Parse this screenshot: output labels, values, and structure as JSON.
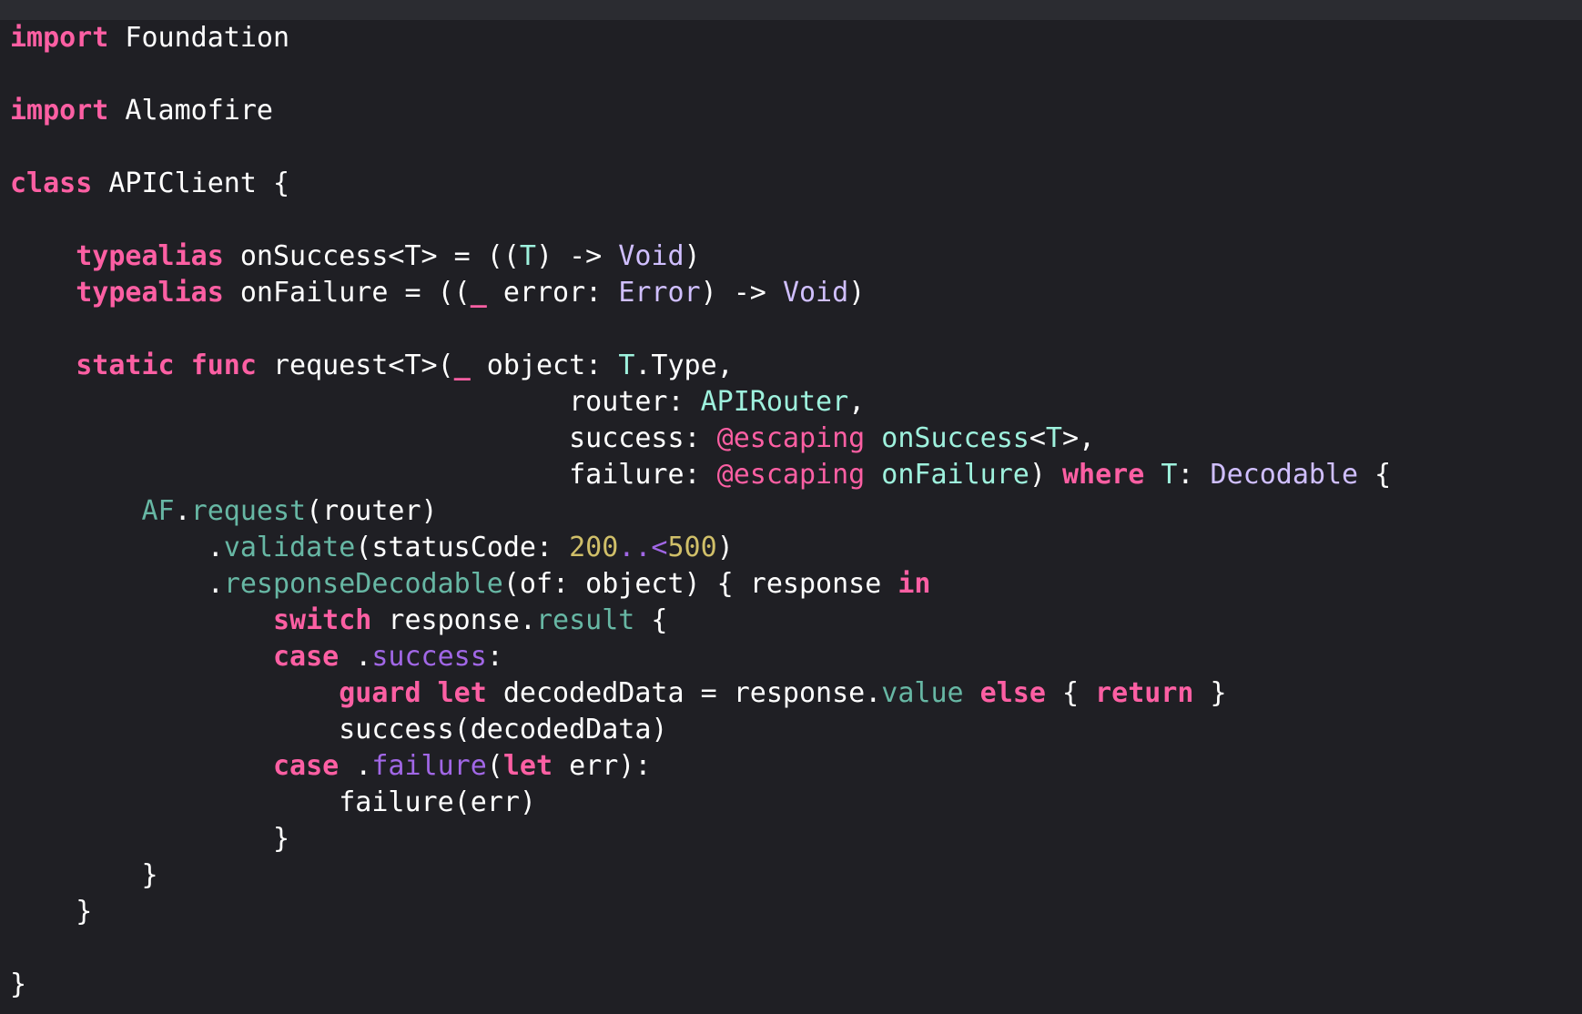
{
  "editor": {
    "language": "Swift",
    "lines": [
      [
        {
          "t": "import",
          "k": "keyword"
        },
        {
          "t": " Foundation",
          "k": "plain"
        }
      ],
      [],
      [
        {
          "t": "import",
          "k": "keyword"
        },
        {
          "t": " Alamofire",
          "k": "plain"
        }
      ],
      [],
      [
        {
          "t": "class",
          "k": "keyword"
        },
        {
          "t": " APIClient {",
          "k": "plain"
        }
      ],
      [],
      [
        {
          "t": "    ",
          "k": "plain"
        },
        {
          "t": "typealias",
          "k": "keyword"
        },
        {
          "t": " onSuccess<T> = ((",
          "k": "plain"
        },
        {
          "t": "T",
          "k": "project"
        },
        {
          "t": ") -> ",
          "k": "plain"
        },
        {
          "t": "Void",
          "k": "type"
        },
        {
          "t": ")",
          "k": "plain"
        }
      ],
      [
        {
          "t": "    ",
          "k": "plain"
        },
        {
          "t": "typealias",
          "k": "keyword"
        },
        {
          "t": " onFailure = ((",
          "k": "plain"
        },
        {
          "t": "_",
          "k": "keyword"
        },
        {
          "t": " error: ",
          "k": "plain"
        },
        {
          "t": "Error",
          "k": "type"
        },
        {
          "t": ") -> ",
          "k": "plain"
        },
        {
          "t": "Void",
          "k": "type"
        },
        {
          "t": ")",
          "k": "plain"
        }
      ],
      [],
      [
        {
          "t": "    ",
          "k": "plain"
        },
        {
          "t": "static",
          "k": "keyword"
        },
        {
          "t": " ",
          "k": "plain"
        },
        {
          "t": "func",
          "k": "keyword"
        },
        {
          "t": " request<T>(",
          "k": "plain"
        },
        {
          "t": "_",
          "k": "keyword"
        },
        {
          "t": " object: ",
          "k": "plain"
        },
        {
          "t": "T",
          "k": "project"
        },
        {
          "t": ".Type,",
          "k": "plain"
        }
      ],
      [
        {
          "t": "                                  router: ",
          "k": "plain"
        },
        {
          "t": "APIRouter",
          "k": "project"
        },
        {
          "t": ",",
          "k": "plain"
        }
      ],
      [
        {
          "t": "                                  success: ",
          "k": "plain"
        },
        {
          "t": "@escaping",
          "k": "attr"
        },
        {
          "t": " ",
          "k": "plain"
        },
        {
          "t": "onSuccess",
          "k": "project"
        },
        {
          "t": "<",
          "k": "plain"
        },
        {
          "t": "T",
          "k": "project"
        },
        {
          "t": ">,",
          "k": "plain"
        }
      ],
      [
        {
          "t": "                                  failure: ",
          "k": "plain"
        },
        {
          "t": "@escaping",
          "k": "attr"
        },
        {
          "t": " ",
          "k": "plain"
        },
        {
          "t": "onFailure",
          "k": "project"
        },
        {
          "t": ") ",
          "k": "plain"
        },
        {
          "t": "where",
          "k": "keyword"
        },
        {
          "t": " ",
          "k": "plain"
        },
        {
          "t": "T",
          "k": "project"
        },
        {
          "t": ": ",
          "k": "plain"
        },
        {
          "t": "Decodable",
          "k": "type"
        },
        {
          "t": " {",
          "k": "plain"
        }
      ],
      [
        {
          "t": "        ",
          "k": "plain"
        },
        {
          "t": "AF",
          "k": "method"
        },
        {
          "t": ".",
          "k": "plain"
        },
        {
          "t": "request",
          "k": "method"
        },
        {
          "t": "(router)",
          "k": "plain"
        }
      ],
      [
        {
          "t": "            .",
          "k": "plain"
        },
        {
          "t": "validate",
          "k": "method"
        },
        {
          "t": "(statusCode: ",
          "k": "plain"
        },
        {
          "t": "200",
          "k": "number"
        },
        {
          "t": "..<",
          "k": "enum"
        },
        {
          "t": "500",
          "k": "number"
        },
        {
          "t": ")",
          "k": "plain"
        }
      ],
      [
        {
          "t": "            .",
          "k": "plain"
        },
        {
          "t": "responseDecodable",
          "k": "method"
        },
        {
          "t": "(of: object) { response ",
          "k": "plain"
        },
        {
          "t": "in",
          "k": "keyword"
        }
      ],
      [
        {
          "t": "                ",
          "k": "plain"
        },
        {
          "t": "switch",
          "k": "keyword"
        },
        {
          "t": " response.",
          "k": "plain"
        },
        {
          "t": "result",
          "k": "method"
        },
        {
          "t": " {",
          "k": "plain"
        }
      ],
      [
        {
          "t": "                ",
          "k": "plain"
        },
        {
          "t": "case",
          "k": "keyword"
        },
        {
          "t": " .",
          "k": "plain"
        },
        {
          "t": "success",
          "k": "enum"
        },
        {
          "t": ":",
          "k": "plain"
        }
      ],
      [
        {
          "t": "                    ",
          "k": "plain"
        },
        {
          "t": "guard",
          "k": "keyword"
        },
        {
          "t": " ",
          "k": "plain"
        },
        {
          "t": "let",
          "k": "keyword"
        },
        {
          "t": " decodedData = response.",
          "k": "plain"
        },
        {
          "t": "value",
          "k": "method"
        },
        {
          "t": " ",
          "k": "plain"
        },
        {
          "t": "else",
          "k": "keyword"
        },
        {
          "t": " { ",
          "k": "plain"
        },
        {
          "t": "return",
          "k": "keyword"
        },
        {
          "t": " }",
          "k": "plain"
        }
      ],
      [
        {
          "t": "                    success(decodedData)",
          "k": "plain"
        }
      ],
      [
        {
          "t": "                ",
          "k": "plain"
        },
        {
          "t": "case",
          "k": "keyword"
        },
        {
          "t": " .",
          "k": "plain"
        },
        {
          "t": "failure",
          "k": "enum"
        },
        {
          "t": "(",
          "k": "plain"
        },
        {
          "t": "let",
          "k": "keyword"
        },
        {
          "t": " err):",
          "k": "plain"
        }
      ],
      [
        {
          "t": "                    failure(err)",
          "k": "plain"
        }
      ],
      [
        {
          "t": "                }",
          "k": "plain"
        }
      ],
      [
        {
          "t": "        }",
          "k": "plain"
        }
      ],
      [
        {
          "t": "    }",
          "k": "plain"
        }
      ],
      [],
      [
        {
          "t": "}",
          "k": "plain"
        }
      ]
    ]
  },
  "theme": {
    "background": "#1f1f24",
    "top_strip": "#2b2c31",
    "plain": "#ffffff",
    "keyword": "#fc5fa3",
    "type": "#d0bfff",
    "project": "#9ef1dd",
    "method": "#67b7a4",
    "enum": "#a167e6",
    "number": "#d0bf69",
    "attr": "#fc5fa3"
  }
}
